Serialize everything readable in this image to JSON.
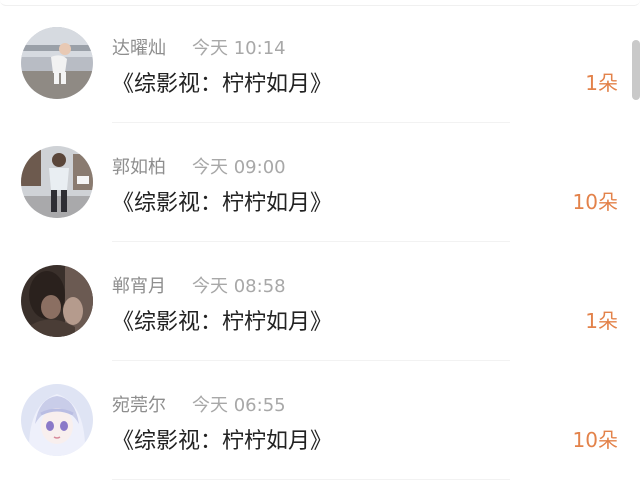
{
  "accent_color": "#e3824a",
  "items": [
    {
      "user": "达曜灿",
      "time": "今天 10:14",
      "title": "《综影视：柠柠如月》",
      "count": "1朵",
      "avatar_icon": "child-photo-avatar"
    },
    {
      "user": "郭如柏",
      "time": "今天 09:00",
      "title": "《综影视：柠柠如月》",
      "count": "10朵",
      "avatar_icon": "street-photo-avatar"
    },
    {
      "user": "郸宵月",
      "time": "今天 08:58",
      "title": "《综影视：柠柠如月》",
      "count": "1朵",
      "avatar_icon": "portrait-photo-avatar"
    },
    {
      "user": "宛莞尔",
      "time": "今天 06:55",
      "title": "《综影视：柠柠如月》",
      "count": "10朵",
      "avatar_icon": "anime-girl-avatar"
    }
  ]
}
